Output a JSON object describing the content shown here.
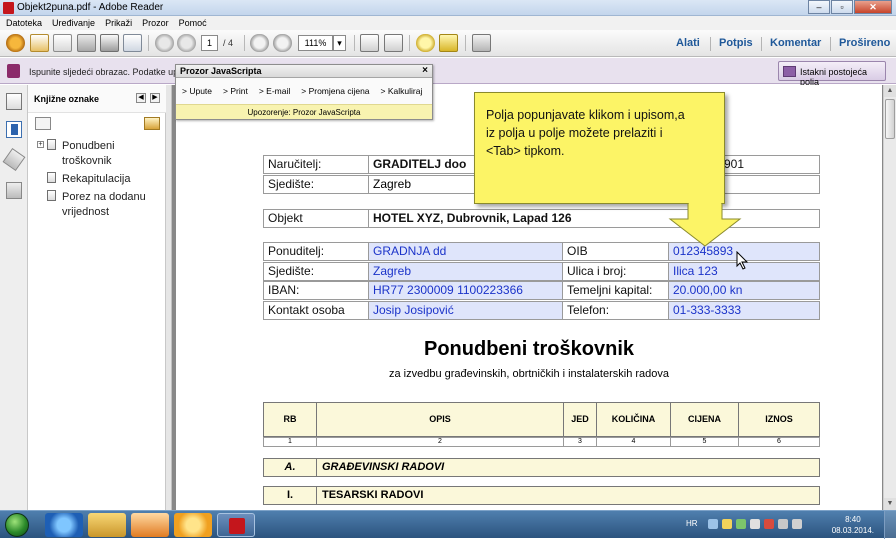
{
  "window": {
    "title": "Objekt2puna.pdf - Adobe Reader"
  },
  "menu": [
    "Datoteka",
    "Uređivanje",
    "Prikaži",
    "Prozor",
    "Pomoć"
  ],
  "toolbar": {
    "page_current": "1",
    "page_total": "/ 4",
    "zoom": "111%",
    "right_links": [
      "Alati",
      "Potpis",
      "Komentar",
      "Proširenо"
    ]
  },
  "formbar": {
    "message": "Ispunite sljedeći obrazac. Podatke upisa",
    "highlight_button": "Istakni postojeća polja"
  },
  "js_window": {
    "title": "Prozor JavaScripta",
    "close": "×",
    "buttons": [
      "> Upute",
      "> Print",
      "> E-mail",
      "> Promjena cijena",
      "> Kalkuliraj"
    ],
    "warning": "Upozorenje: Prozor JavaScripta"
  },
  "bookmarks": {
    "title": "Knjižne oznake",
    "items": [
      "Ponudbeni troškovnik",
      "Rekapitulacija",
      "Porez na dodanu vrijednost"
    ]
  },
  "document": {
    "narucitelj_label": "Naručitelj:",
    "narucitelj_value": "GRADITELJ doo",
    "narucitelj_oib_tail": "901",
    "sjediste1_label": "Sjedište:",
    "sjediste1_value": "Zagreb",
    "objekt_label": "Objekt",
    "objekt_value": "HOTEL XYZ, Dubrovnik, Lapad 126",
    "ponuditelj_label": "Ponuditelj:",
    "ponuditelj_value": "GRADNJA dd",
    "oib_label": "OIB",
    "oib_value": "012345893",
    "sjediste2_label": "Sjedište:",
    "sjediste2_value": "Zagreb",
    "ulica_label": "Ulica i broj:",
    "ulica_value": "Ilica 123",
    "iban_label": "IBAN:",
    "iban_value": "HR77 2300009 1100223366",
    "kapital_label": "Temeljni kapital:",
    "kapital_value": "20.000,00 kn",
    "kontakt_label": "Kontakt osoba",
    "kontakt_value": "Josip Josipović",
    "telefon_label": "Telefon:",
    "telefon_value": "01-333-3333",
    "title": "Ponudbeni troškovnik",
    "subtitle": "za izvedbu građevinskih, obrtničkih i instalaterskih radova",
    "table_headers": [
      "RB",
      "OPIS",
      "JED",
      "KOLIČINA",
      "CIJENA",
      "IZNOS"
    ],
    "table_numbers": [
      "1",
      "2",
      "3",
      "4",
      "5",
      "6"
    ],
    "section_a_num": "A.",
    "section_a_label": "GRAĐEVINSKI RADOVI",
    "section_i_num": "I.",
    "section_i_label": "TESARSKI RADOVI"
  },
  "callout": {
    "text_line1": "Polja popunjavate klikom i upisom,a",
    "text_line2": "iz polja u polje možete prelaziti i",
    "text_line3": "<Tab> tipkom."
  },
  "taskbar": {
    "lang": "HR",
    "time": "8:40",
    "date": "08.03.2014."
  },
  "colors": {
    "field_fill": "#dfe5fb",
    "field_text": "#1b33c9",
    "callout": "#fcf466",
    "header_fill": "#fbf8da",
    "link_blue": "#1f5899"
  }
}
